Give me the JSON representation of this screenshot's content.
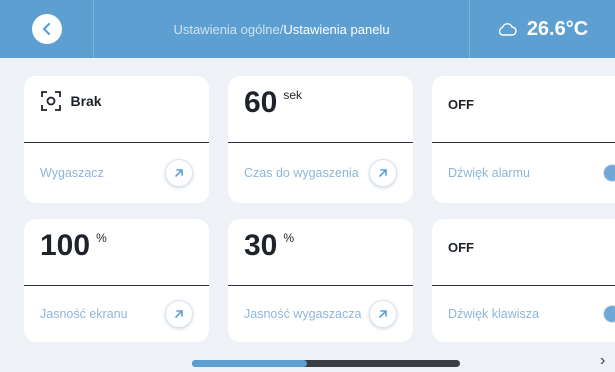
{
  "header": {
    "breadcrumb_parent": "Ustawienia ogólne",
    "breadcrumb_separator": "/",
    "breadcrumb_current": "Ustawienia panelu",
    "temperature": "26.6°C",
    "weather_icon": "cloud-icon"
  },
  "tiles": {
    "screensaver": {
      "value": "Brak",
      "label": "Wygaszacz",
      "icon": "focus-frame-icon"
    },
    "screensaver_time": {
      "value": "60",
      "unit": "sek",
      "label": "Czas do wygaszenia"
    },
    "alarm_sound": {
      "value": "OFF",
      "label": "Dźwięk alarmu",
      "enabled": false
    },
    "screen_brightness": {
      "value": "100",
      "unit": "%",
      "label": "Jasność ekranu"
    },
    "screensaver_brightness": {
      "value": "30",
      "unit": "%",
      "label": "Jasność wygaszacza"
    },
    "key_sound": {
      "value": "OFF",
      "label": "Dźwięk klawisza",
      "enabled": false
    }
  },
  "scroll": {
    "position_fraction": 0.0,
    "thumb_fraction": 0.43
  },
  "colors": {
    "accent": "#5c9fd0",
    "label": "#8fb6d8",
    "background": "#eef1f6"
  }
}
